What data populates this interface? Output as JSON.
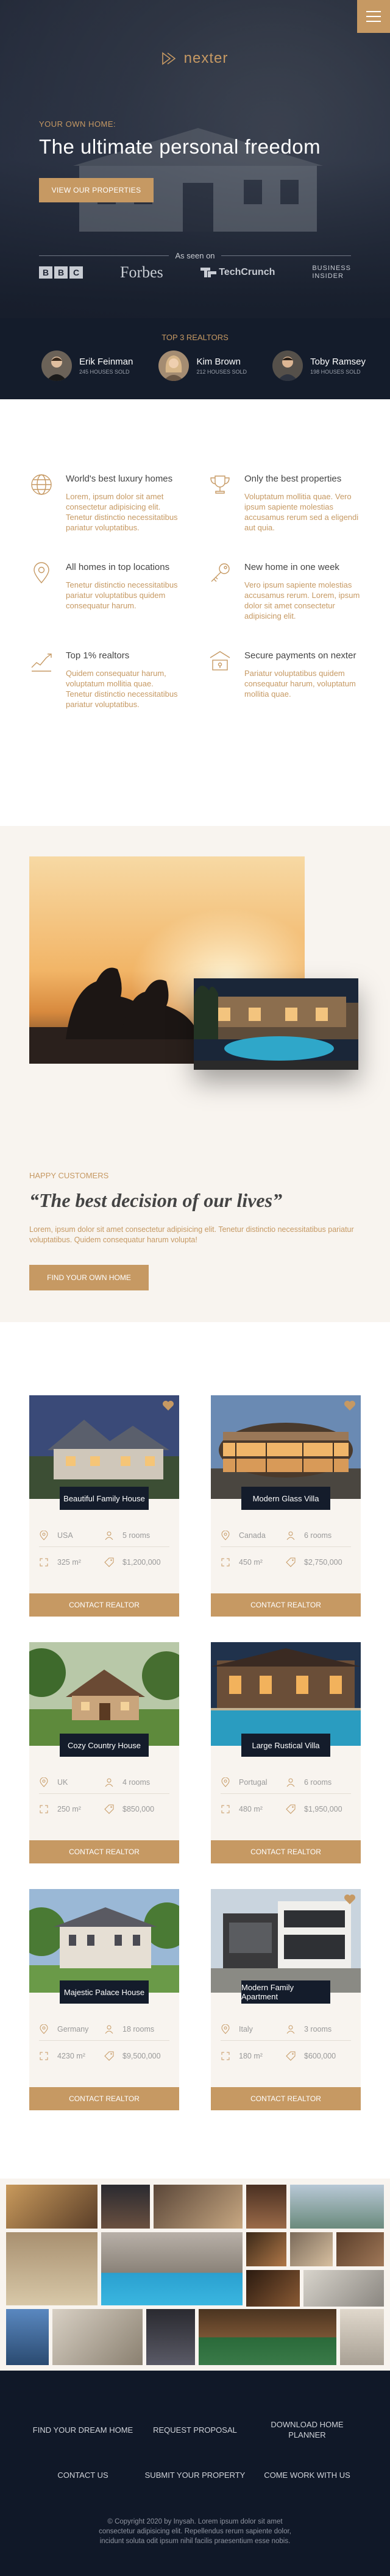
{
  "header": {
    "logo_text": "nexter",
    "eyebrow": "Your own home:",
    "title": "The ultimate personal freedom",
    "cta_label": "View our properties",
    "seen_on_label": "As seen on",
    "press": {
      "bbc": [
        "B",
        "B",
        "C"
      ],
      "forbes": "Forbes",
      "techcrunch": "TechCrunch",
      "business_insider": [
        "Business",
        "Insider"
      ]
    }
  },
  "realtors": {
    "title": "Top 3 Realtors",
    "items": [
      {
        "name": "Erik Feinman",
        "sold": "245 houses sold"
      },
      {
        "name": "Kim Brown",
        "sold": "212 houses sold"
      },
      {
        "name": "Toby Ramsey",
        "sold": "198 houses sold"
      }
    ]
  },
  "features": [
    {
      "icon": "globe-icon",
      "title": "World's best luxury homes",
      "text": "Lorem, ipsum dolor sit amet consectetur adipisicing elit. Tenetur distinctio necessitatibus pariatur voluptatibus."
    },
    {
      "icon": "trophy-icon",
      "title": "Only the best properties",
      "text": "Voluptatum mollitia quae. Vero ipsum sapiente molestias accusamus rerum sed a eligendi aut quia."
    },
    {
      "icon": "map-pin-icon",
      "title": "All homes in top locations",
      "text": "Tenetur distinctio necessitatibus pariatur voluptatibus quidem consequatur harum."
    },
    {
      "icon": "key-icon",
      "title": "New home in one week",
      "text": "Vero ipsum sapiente molestias accusamus rerum. Lorem, ipsum dolor sit amet consectetur adipisicing elit."
    },
    {
      "icon": "graph-icon",
      "title": "Top 1% realtors",
      "text": "Quidem consequatur harum, voluptatum mollitia quae. Tenetur distinctio necessitatibus pariatur voluptatibus."
    },
    {
      "icon": "lock-icon",
      "title": "Secure payments on nexter",
      "text": "Pariatur voluptatibus quidem consequatur harum, voluptatum mollitia quae."
    }
  ],
  "story": {
    "eyebrow": "Happy Customers",
    "title": "“The best decision of our lives”",
    "text": "Lorem, ipsum dolor sit amet consectetur adipisicing elit. Tenetur distinctio necessitatibus pariatur voluptatibus. Quidem consequatur harum volupta!",
    "cta_label": "Find your own home"
  },
  "homes": [
    {
      "name": "Beautiful Family House",
      "country": "USA",
      "rooms": "5 rooms",
      "area": "325 m²",
      "price": "$1,200,000",
      "liked": true,
      "cta": "Contact realtor"
    },
    {
      "name": "Modern Glass Villa",
      "country": "Canada",
      "rooms": "6 rooms",
      "area": "450 m²",
      "price": "$2,750,000",
      "liked": true,
      "cta": "Contact realtor"
    },
    {
      "name": "Cozy Country House",
      "country": "UK",
      "rooms": "4 rooms",
      "area": "250 m²",
      "price": "$850,000",
      "liked": false,
      "cta": "Contact realtor"
    },
    {
      "name": "Large Rustical Villa",
      "country": "Portugal",
      "rooms": "6 rooms",
      "area": "480 m²",
      "price": "$1,950,000",
      "liked": false,
      "cta": "Contact realtor"
    },
    {
      "name": "Majestic Palace House",
      "country": "Germany",
      "rooms": "18 rooms",
      "area": "4230 m²",
      "price": "$9,500,000",
      "liked": false,
      "cta": "Contact realtor"
    },
    {
      "name": "Modern Family Apartment",
      "country": "Italy",
      "rooms": "3 rooms",
      "area": "180 m²",
      "price": "$600,000",
      "liked": true,
      "cta": "Contact realtor"
    }
  ],
  "footer": {
    "links": [
      "Find your dream home",
      "Request proposal",
      "Download home planner",
      "Contact us",
      "Submit your property",
      "Come work with us"
    ],
    "copyright": "© Copyright 2020 by Inysah. Lorem ipsum dolor sit amet consectetur adipisicing elit. Repellendus rerum sapiente dolor, incidunt soluta odit ipsum nihil facilis praesentium esse nobis."
  },
  "colors": {
    "accent": "#c69963",
    "dark": "#101828",
    "light_bg": "#f8f4ef"
  }
}
